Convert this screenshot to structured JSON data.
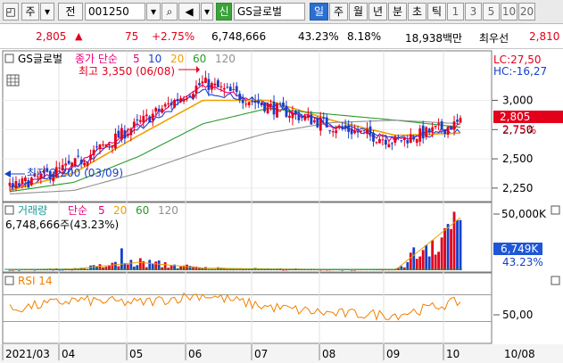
{
  "toolbar": {
    "market": "주",
    "code_prefix": "전",
    "code": "001250",
    "credit_badge": "신",
    "stock_name": "GS글로벌",
    "periods": [
      "일",
      "주",
      "월",
      "년",
      "분",
      "초",
      "틱"
    ],
    "selected_period": "일",
    "minutes": [
      "1",
      "3",
      "5",
      "10",
      "20"
    ]
  },
  "info": {
    "price": "2,805",
    "change": "75",
    "change_pct": "+2.75%",
    "volume": "6,748,666",
    "vol_ratio": "43.23%",
    "turnover": "8.18%",
    "amount": "18,938백만",
    "best_quote_label": "최우선",
    "best_quote": "2,810"
  },
  "price_panel": {
    "stock_label": "GS글로벌",
    "ma_title": "종가 단순",
    "ma_periods": [
      "5",
      "10",
      "20",
      "60",
      "120"
    ],
    "lc": "LC:27,50",
    "hc": "HC:-16,27",
    "y_ticks": [
      "3,000",
      "2,750",
      "2,500",
      "2,250"
    ],
    "current_price": "2,805",
    "current_change": "2.75%",
    "high_note": "최고 3,350 (06/08)",
    "low_note": "최저 2,200 (03/09)"
  },
  "volume_panel": {
    "label": "거래량",
    "ma_title": "단순",
    "ma_periods": [
      "5",
      "20",
      "60",
      "120"
    ],
    "info": "6,748,666주(43.23%)",
    "y_tick": "50,000K",
    "current_volume": "6,749K",
    "current_ratio": "43.23%"
  },
  "rsi_panel": {
    "label": "RSI 14",
    "y_tick": "50,00"
  },
  "x_axis": {
    "labels": [
      "2021/03",
      "04",
      "05",
      "06",
      "07",
      "08",
      "09",
      "10"
    ],
    "cursor_date": "10/08"
  },
  "colors": {
    "up": "#e3001b",
    "down": "#1540c8",
    "ma5": "#e8007a",
    "ma10": "#1a3fd0",
    "ma20": "#f0a000",
    "ma60": "#2a9b2a",
    "ma120": "#909090",
    "rsi": "#f08000",
    "current_badge": "#e3001b",
    "volume_badge": "#1e56d6"
  },
  "chart_data": [
    {
      "type": "candlestick",
      "title": "GS글로벌",
      "x": [
        "2021-03",
        "2021-04",
        "2021-05",
        "2021-06",
        "2021-07",
        "2021-08",
        "2021-09",
        "2021-10"
      ],
      "series": [
        {
          "name": "종가",
          "values": [
            2250,
            2450,
            2800,
            3150,
            2950,
            2780,
            2650,
            2805
          ]
        },
        {
          "name": "5",
          "values": [
            2240,
            2430,
            2790,
            3130,
            2960,
            2790,
            2660,
            2780
          ]
        },
        {
          "name": "10",
          "values": [
            2235,
            2410,
            2760,
            3080,
            2980,
            2800,
            2670,
            2740
          ]
        },
        {
          "name": "20",
          "values": [
            2230,
            2380,
            2700,
            3000,
            3000,
            2830,
            2700,
            2720
          ]
        },
        {
          "name": "60",
          "values": [
            2220,
            2300,
            2520,
            2800,
            2930,
            2880,
            2830,
            2770
          ]
        },
        {
          "name": "120",
          "values": [
            2200,
            2230,
            2380,
            2570,
            2720,
            2810,
            2830,
            2800
          ]
        }
      ],
      "ylim": [
        2150,
        3400
      ],
      "annotations": [
        "최고 3,350 (06/08)",
        "최저 2,200 (03/09)"
      ]
    },
    {
      "type": "bar",
      "title": "거래량",
      "categories": [
        "2021-03",
        "2021-04",
        "2021-05",
        "2021-06",
        "2021-07",
        "2021-08",
        "2021-09",
        "2021-10"
      ],
      "values": [
        600,
        1500,
        9000,
        2500,
        1500,
        800,
        900,
        60000
      ],
      "ylabel": "K",
      "ylim": [
        0,
        65000
      ]
    },
    {
      "type": "line",
      "title": "RSI 14",
      "x": [
        "2021-03",
        "2021-04",
        "2021-05",
        "2021-06",
        "2021-07",
        "2021-08",
        "2021-09",
        "2021-10"
      ],
      "series": [
        {
          "name": "RSI 14",
          "values": [
            48,
            62,
            58,
            70,
            52,
            42,
            40,
            60
          ]
        }
      ],
      "ylim": [
        0,
        100
      ]
    }
  ]
}
